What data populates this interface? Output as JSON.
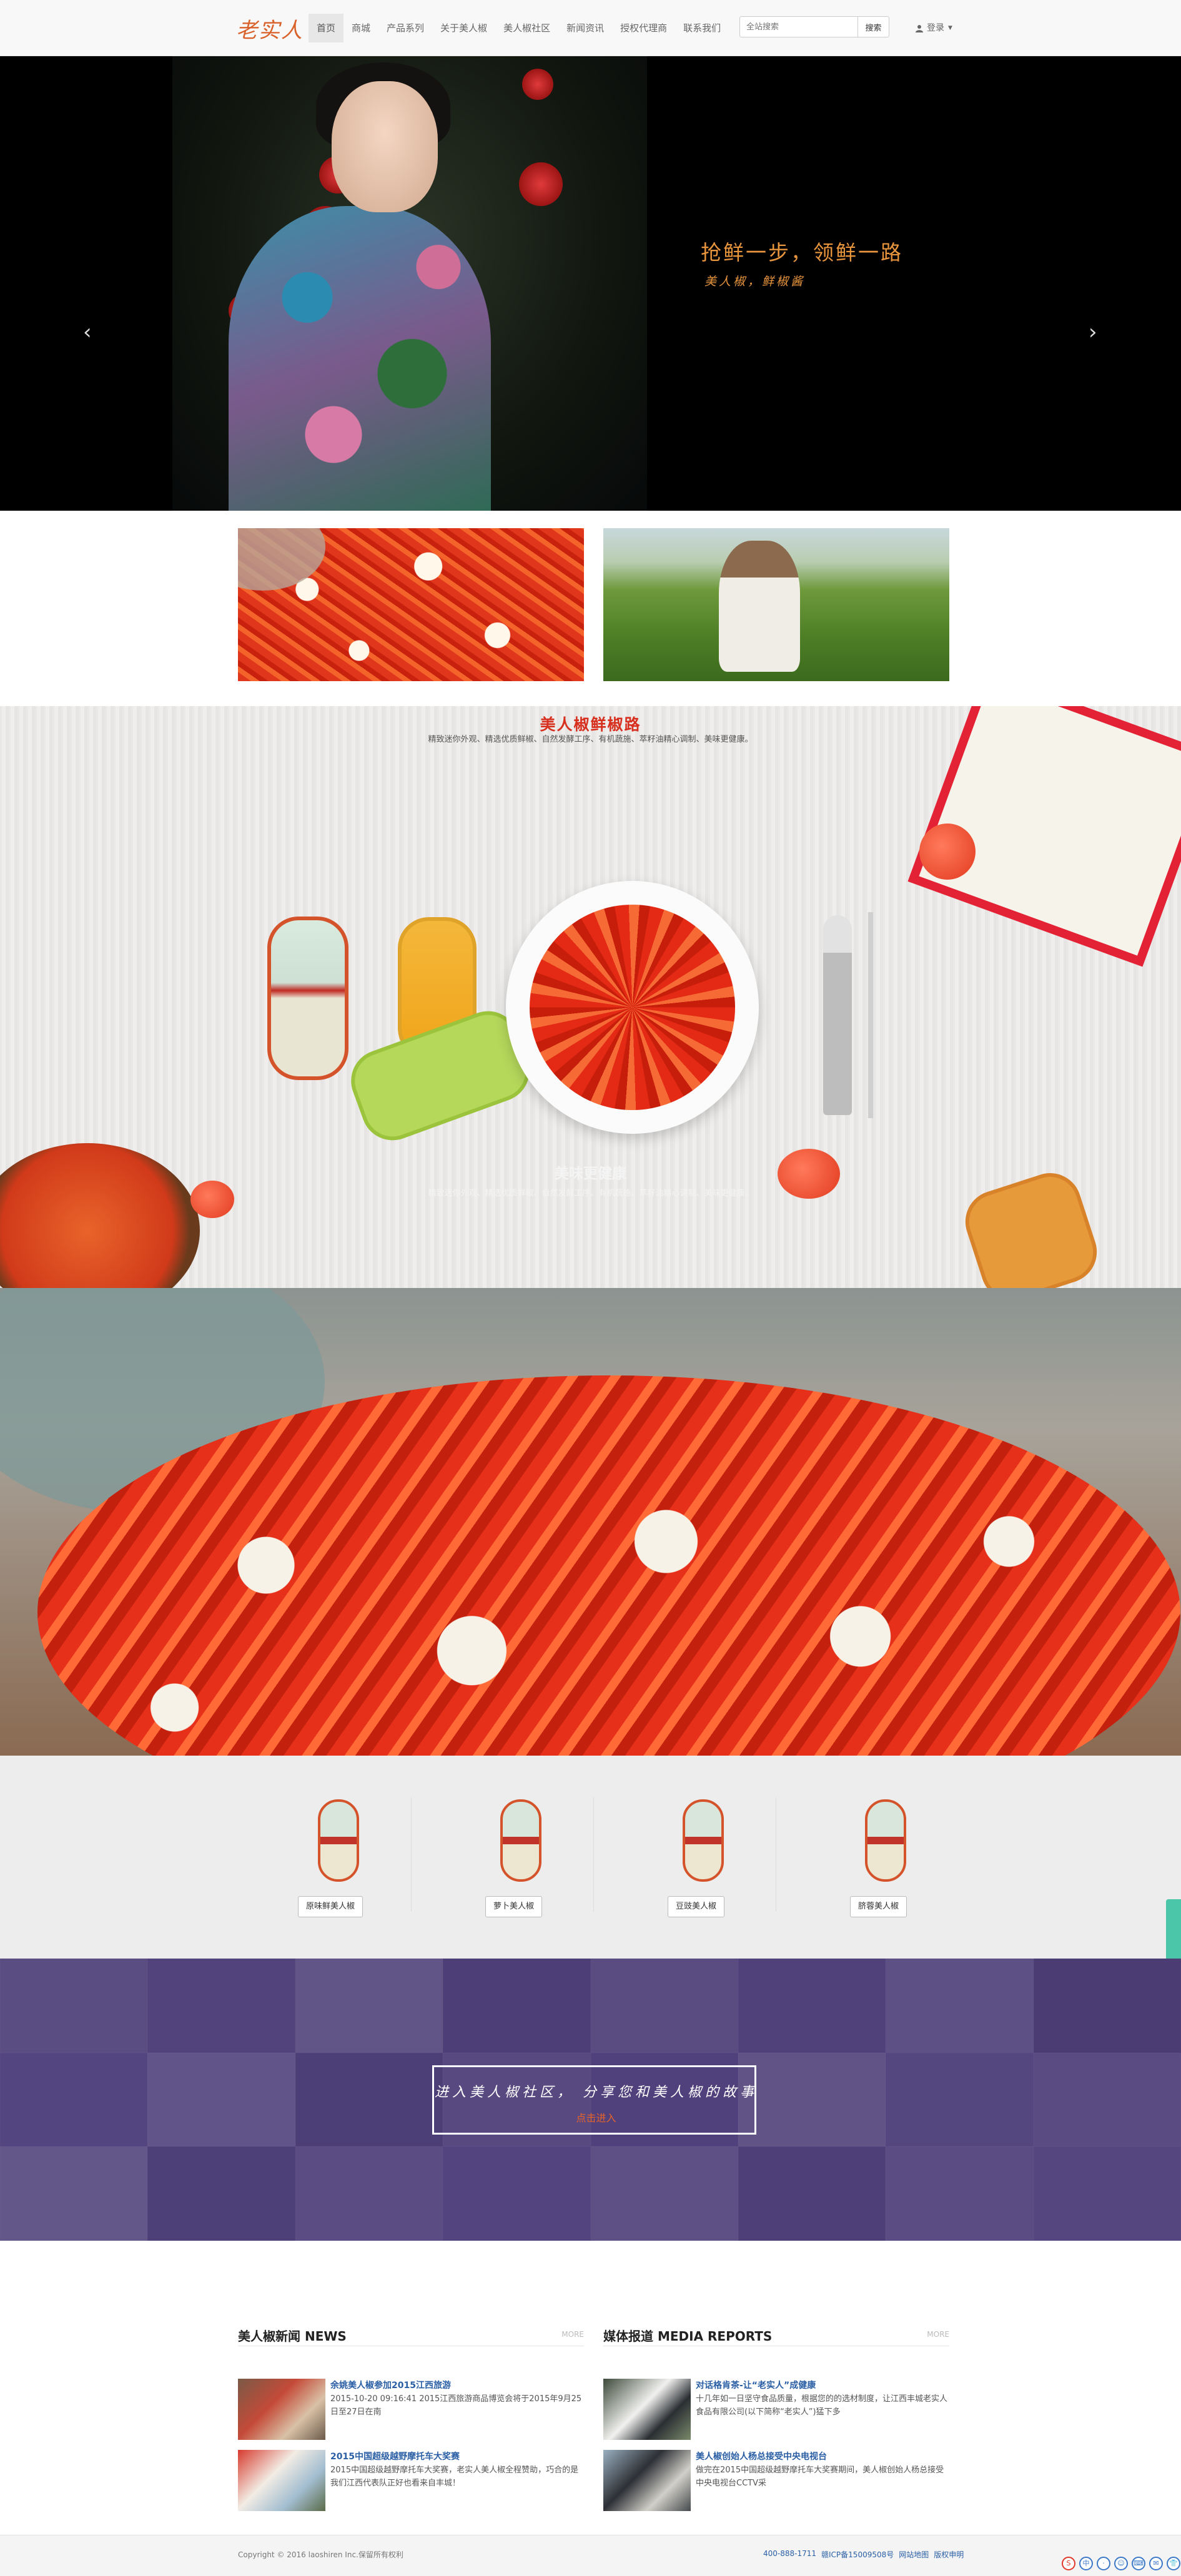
{
  "nav": {
    "logo": "老实人",
    "items": [
      "首页",
      "商城",
      "产品系列",
      "关于美人椒",
      "美人椒社区",
      "新闻资讯",
      "授权代理商",
      "联系我们"
    ],
    "active_index": 0,
    "search_placeholder": "全站搜索",
    "search_button": "搜索",
    "login": "登录"
  },
  "hero": {
    "slogan": "抢鲜一步，领鲜一路",
    "sub": "美人椒，鲜椒酱",
    "prev_icon": "‹",
    "next_icon": "›",
    "slides": 2,
    "active_slide": 0
  },
  "road": {
    "title": "美人椒鲜椒路",
    "desc": "精致迷你外观、精选优质鲜椒、自然发酵工序、有机蔬施、萃籽油精心调制、美味更健康。",
    "sub_title": "美味更健康",
    "sub_desc": "精致迷你外观、精选优质鲜椒、自然发酵工序、有机蔬施、萃籽油精心调制、美味更健康。"
  },
  "products": [
    {
      "label": "原味鲜美人椒"
    },
    {
      "label": "萝卜美人椒"
    },
    {
      "label": "豆豉美人椒"
    },
    {
      "label": "脐蓉美人椒"
    }
  ],
  "community": {
    "text": "进入美人椒社区， 分享您和美人椒的故事",
    "link": "点击进入"
  },
  "news": {
    "title": "美人椒新闻  NEWS",
    "more": "MORE",
    "items": [
      {
        "title": "余姚美人椒参加2015江西旅游",
        "desc": "2015-10-20 09:16:41 2015江西旅游商品博览会将于2015年9月25日至27日在南"
      },
      {
        "title": "2015中国超级越野摩托车大奖赛",
        "desc": "2015中国超级越野摩托车大奖赛，老实人美人椒全程赞助，巧合的是我们江西代表队正好也看来自丰城！"
      }
    ]
  },
  "media": {
    "title": "媒体报道  MEDIA REPORTS",
    "more": "MORE",
    "items": [
      {
        "title": "对话格肯茶-让“老实人”成健康",
        "desc": "十几年如一日坚守食品质量，根据您的的选材制度，让江西丰城老实人食品有限公司(以下简称“老实人”)猛下多"
      },
      {
        "title": "美人椒创始人杨总接受中央电视台",
        "desc": "做完在2015中国超级越野摩托车大奖赛期间，美人椒创始人杨总接受中央电视台CCTV采"
      }
    ]
  },
  "footer": {
    "copyright": "Copyright © 2016 laoshiren Inc.保留所有权利",
    "links": [
      "400-888-1711",
      "赣ICP备15009508号",
      "网站地图",
      "版权申明"
    ]
  },
  "tray": [
    "S",
    "中",
    "·",
    "☺",
    "⌨",
    "✉",
    "👕",
    "⚙"
  ],
  "colors": {
    "accent": "#e8953d",
    "red": "#d7301f",
    "link": "#2a5fa5",
    "community": "#4c3e70"
  }
}
